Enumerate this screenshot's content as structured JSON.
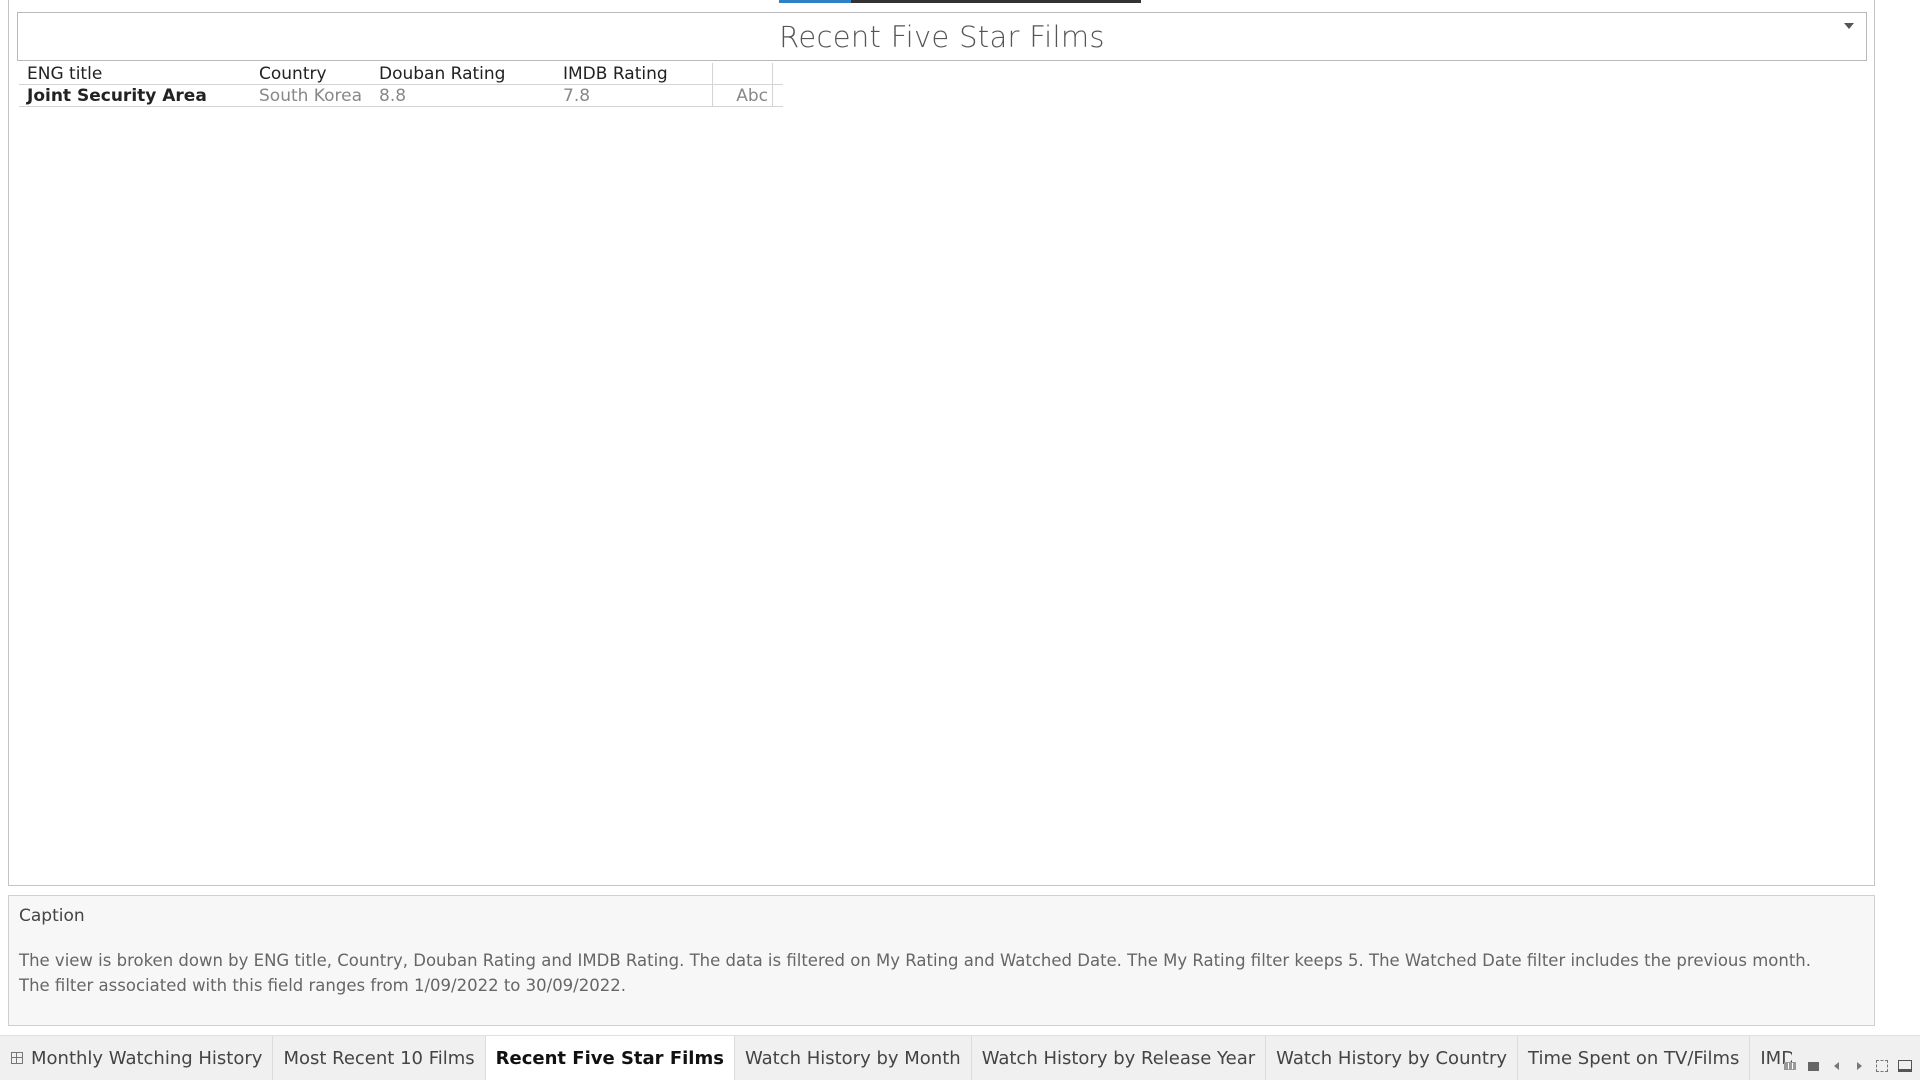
{
  "dashboard": {
    "title": "Recent Five Star Films"
  },
  "crosstab": {
    "headers": [
      "ENG title",
      "Country",
      "Douban Rating",
      "IMDB Rating",
      ""
    ],
    "rows": [
      {
        "eng_title": "Joint Security Area",
        "country": "South Korea",
        "douban": "8.8",
        "imdb": "7.8",
        "mark": "Abc"
      }
    ]
  },
  "caption": {
    "title": "Caption",
    "line1": "The view is broken down by ENG title, Country, Douban Rating and IMDB Rating. The data is filtered on My Rating and Watched Date. The My Rating filter keeps 5. The Watched Date filter includes the previous month.",
    "line2": "The filter associated with this field ranges from 1/09/2022 to 30/09/2022."
  },
  "tabs": [
    {
      "label": "Monthly Watching History",
      "active": false
    },
    {
      "label": "Most Recent 10 Films",
      "active": false
    },
    {
      "label": "Recent Five Star Films",
      "active": true
    },
    {
      "label": "Watch History by Month",
      "active": false
    },
    {
      "label": "Watch History by Release Year",
      "active": false
    },
    {
      "label": "Watch History by Country",
      "active": false
    },
    {
      "label": "Time Spent on TV/Films",
      "active": false
    },
    {
      "label": "IMDB vs Dout",
      "active": false
    }
  ],
  "colors": {
    "accent": "#2f80c7",
    "active_tab_bg": "#ffffff"
  },
  "icons": [
    "chevron-down-icon",
    "grid-icon",
    "sheet-sorter-icon",
    "filmstrip-icon",
    "previous-icon",
    "next-icon",
    "fullscreen-icon",
    "presentation-icon"
  ]
}
